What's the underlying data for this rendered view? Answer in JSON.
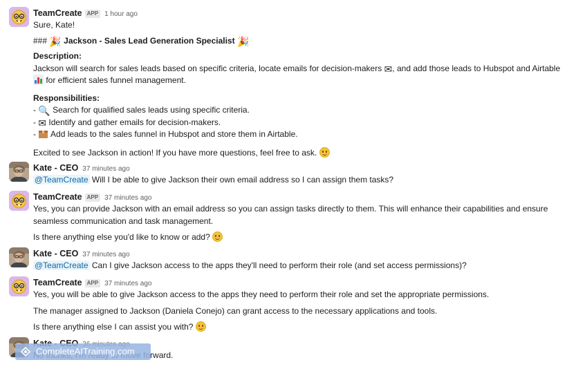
{
  "messages": [
    {
      "author": "TeamCreate",
      "badge": "APP",
      "time": "1 hour ago",
      "greeting": "Sure, Kate!",
      "heading_prefix": "###",
      "heading_title": "Jackson - Sales Lead Generation Specialist",
      "desc_label": "Description:",
      "desc_text_a": "Jackson will search for sales leads based on specific criteria, locate emails for decision-makers",
      "desc_text_b": ", and add those leads to Hubspot and Airtable",
      "desc_text_c": "for efficient sales funnel management.",
      "resp_label": "Responsibilities:",
      "responsibilities": [
        "Search for qualified sales leads using specific criteria.",
        "Identify and gather emails for decision-makers.",
        "Add leads to the sales funnel in Hubspot and store them in Airtable."
      ],
      "closing": "Excited to see Jackson in action! If you have more questions, feel free to ask."
    },
    {
      "author": "Kate - CEO",
      "time": "37 minutes ago",
      "mention": "@TeamCreate",
      "text": "Will I be able to give Jackson their own email address so I can assign them tasks?"
    },
    {
      "author": "TeamCreate",
      "badge": "APP",
      "time": "37 minutes ago",
      "text_1": "Yes, you can provide Jackson with an email address so you can assign tasks directly to them. This will enhance their capabilities and ensure",
      "text_2": "seamless communication and task management.",
      "text_3": "Is there anything else you'd like to know or add?"
    },
    {
      "author": "Kate - CEO",
      "time": "37 minutes ago",
      "mention": "@TeamCreate",
      "text": "Can I give Jackson access to the apps they'll need to perform their role (and set access permissions)?"
    },
    {
      "author": "TeamCreate",
      "badge": "APP",
      "time": "37 minutes ago",
      "text_1": "Yes, you will be able to give Jackson access to the apps they need to perform their role and set the appropriate permissions.",
      "text_2": "The manager assigned to Jackson (Daniela Conejo) can grant access to the necessary applications and tools.",
      "text_3": "Is there anything else I can assist you with?"
    },
    {
      "author": "Kate - CEO",
      "time": "36 minutes ago",
      "text": "No thanks, I'm ready to move forward."
    }
  ],
  "watermark": "CompleteAITraining.com",
  "icons": {
    "bot_avatar": "nerd-face-avatar",
    "human_avatar": "kate-photo-avatar",
    "tada": "party-popper-icon",
    "envelope": "envelope-icon",
    "chart": "bar-chart-icon",
    "magnifier": "magnifying-glass-icon",
    "box": "package-icon",
    "smile": "smiling-face-icon"
  },
  "colors": {
    "mention_text": "#1264a3",
    "mention_bg": "#e8f5fa",
    "bot_avatar_bg": "#d9b8e8",
    "timestamp": "#616061"
  }
}
